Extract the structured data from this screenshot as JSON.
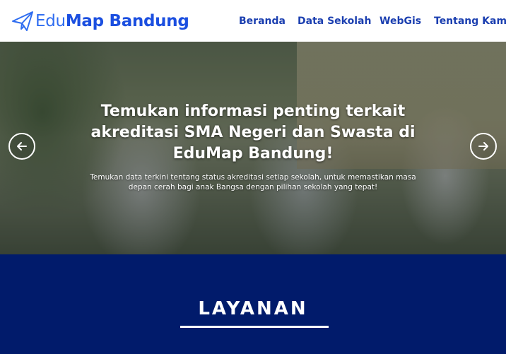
{
  "brand": {
    "logo_light": "Edu",
    "logo_bold": "Map Bandung",
    "icon": "paper-plane-icon",
    "color": "#1b4fe0"
  },
  "nav": {
    "items": [
      {
        "label": "Beranda"
      },
      {
        "label": "Data Sekolah"
      },
      {
        "label": "WebGis"
      },
      {
        "label": "Tentang Kami"
      }
    ],
    "color": "#1b3fb0"
  },
  "hero": {
    "title": "Temukan informasi penting terkait akreditasi SMA Negeri dan Swasta di EduMap Bandung!",
    "subtitle": "Temukan data terkini tentang status akreditasi setiap sekolah, untuk memastikan masa depan cerah bagi anak Bangsa dengan pilihan sekolah yang tepat!",
    "prev_icon": "arrow-left-icon",
    "next_icon": "arrow-right-icon"
  },
  "services": {
    "title": "LAYANAN",
    "background": "#011b6b"
  }
}
